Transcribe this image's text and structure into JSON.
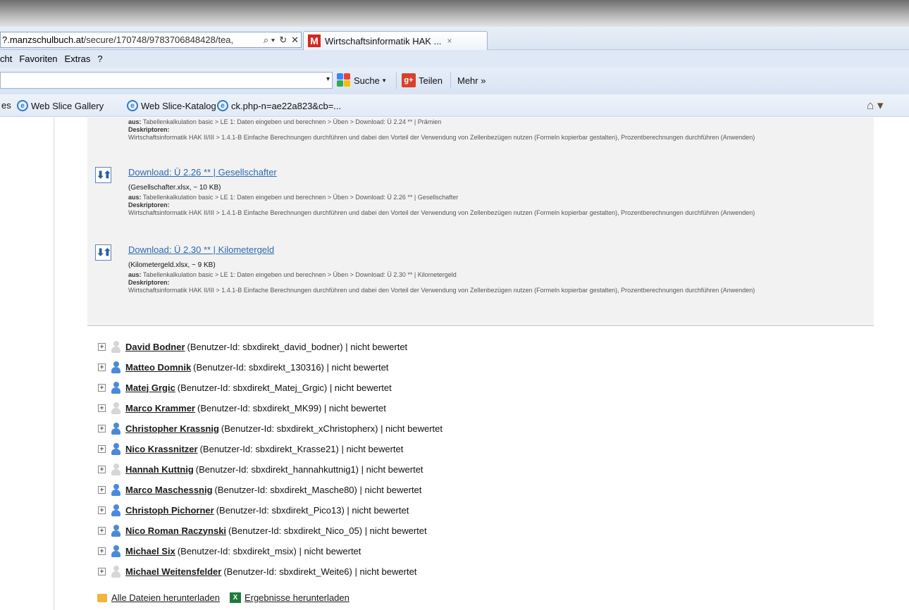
{
  "browser": {
    "address": {
      "url_prefix": "?.manzschulbuch.at",
      "url_rest": "/secure/170748/9783706848428/tea,",
      "search_glyph": "⌕ ▾",
      "refresh_glyph": "↻",
      "close_glyph": "✕"
    },
    "tab": {
      "favicon": "M",
      "title": "Wirtschaftsinformatik HAK ...",
      "close": "×"
    },
    "menu": [
      "cht",
      "Favoriten",
      "Extras",
      "?"
    ],
    "commandbar": {
      "dropdown": "▾",
      "search_label": "Suche",
      "share_label": "Teilen",
      "share_icon": "g+",
      "more_label": "Mehr »"
    },
    "favorites": {
      "cut_label": "es",
      "items": [
        "Web Slice Gallery",
        "Web Slice-Katalog",
        "ck.php-n=ae22a823&cb=..."
      ],
      "home_glyph": "⌂ ▾"
    }
  },
  "downloads": {
    "partial_top": {
      "aus": "aus:",
      "aus_path": "Tabellenkalkulation basic > LE 1: Daten eingeben und berechnen > Üben > Download: Ü 2.24 ** | Prämien",
      "desc_label": "Deskriptoren:",
      "desc_text": "Wirtschaftsinformatik HAK II/III > 1.4.1-B Einfache Berechnungen durchführen und dabei den Vorteil der Verwendung von Zellenbezügen nutzen (Formeln kopierbar gestalten), Prozentberechnungen durchführen (Anwenden)"
    },
    "items": [
      {
        "title": "Download: Ü 2.26 ** | Gesellschafter",
        "file": "(Gesellschafter.xlsx, ~ 10 KB)",
        "aus": "aus:",
        "aus_path": "Tabellenkalkulation basic > LE 1: Daten eingeben und berechnen > Üben > Download: Ü 2.26 ** | Gesellschafter",
        "desc_label": "Deskriptoren:",
        "desc_text": "Wirtschaftsinformatik HAK II/III > 1.4.1-B Einfache Berechnungen durchführen und dabei den Vorteil der Verwendung von Zellenbezügen nutzen (Formeln kopierbar gestalten), Prozentberechnungen durchführen (Anwenden)"
      },
      {
        "title": "Download: Ü 2.30 ** | Kilometergeld",
        "file": "(Kilometergeld.xlsx, ~ 9 KB)",
        "aus": "aus:",
        "aus_path": "Tabellenkalkulation basic > LE 1: Daten eingeben und berechnen > Üben > Download: Ü 2.30 ** | Kilometergeld",
        "desc_label": "Deskriptoren:",
        "desc_text": "Wirtschaftsinformatik HAK II/III > 1.4.1-B Einfache Berechnungen durchführen und dabei den Vorteil der Verwendung von Zellenbezügen nutzen (Formeln kopierbar gestalten), Prozentberechnungen durchführen (Anwenden)"
      }
    ],
    "icon_glyph": "⬇⬆"
  },
  "students": [
    {
      "name": "David Bodner",
      "detail": "(Benutzer-Id: sbxdirekt_david_bodner) | nicht bewertet",
      "avatar": "grey"
    },
    {
      "name": "Matteo Domnik",
      "detail": "(Benutzer-Id: sbxdirekt_130316) | nicht bewertet",
      "avatar": "blue"
    },
    {
      "name": "Matej Grgic",
      "detail": "(Benutzer-Id: sbxdirekt_Matej_Grgic) | nicht bewertet",
      "avatar": "blue"
    },
    {
      "name": "Marco Krammer",
      "detail": "(Benutzer-Id: sbxdirekt_MK99) | nicht bewertet",
      "avatar": "grey"
    },
    {
      "name": "Christopher Krassnig",
      "detail": "(Benutzer-Id: sbxdirekt_xChristopherx) | nicht bewertet",
      "avatar": "blue"
    },
    {
      "name": "Nico Krassnitzer",
      "detail": "(Benutzer-Id: sbxdirekt_Krasse21) | nicht bewertet",
      "avatar": "blue"
    },
    {
      "name": "Hannah Kuttnig",
      "detail": "(Benutzer-Id: sbxdirekt_hannahkuttnig1) | nicht bewertet",
      "avatar": "grey"
    },
    {
      "name": "Marco Maschessnig",
      "detail": "(Benutzer-Id: sbxdirekt_Masche80) | nicht bewertet",
      "avatar": "blue"
    },
    {
      "name": "Christoph Pichorner",
      "detail": "(Benutzer-Id: sbxdirekt_Pico13) | nicht bewertet",
      "avatar": "blue"
    },
    {
      "name": "Nico Roman Raczynski",
      "detail": "(Benutzer-Id: sbxdirekt_Nico_05) | nicht bewertet",
      "avatar": "blue"
    },
    {
      "name": "Michael Six",
      "detail": "(Benutzer-Id: sbxdirekt_msix) | nicht bewertet",
      "avatar": "blue"
    },
    {
      "name": "Michael Weitensfelder",
      "detail": "(Benutzer-Id: sbxdirekt_Weite6) | nicht bewertet",
      "avatar": "grey"
    }
  ],
  "expand_glyph": "+",
  "footer": {
    "download_all": "Alle Dateien herunterladen",
    "excel_icon": "X",
    "download_results": "Ergebnisse herunterladen"
  },
  "colors": {
    "link_blue": "#2a6bb0",
    "panel_bg": "#f2f2f2",
    "avatar_active": "#4a8ad8",
    "avatar_inactive": "#d6d6d6"
  }
}
